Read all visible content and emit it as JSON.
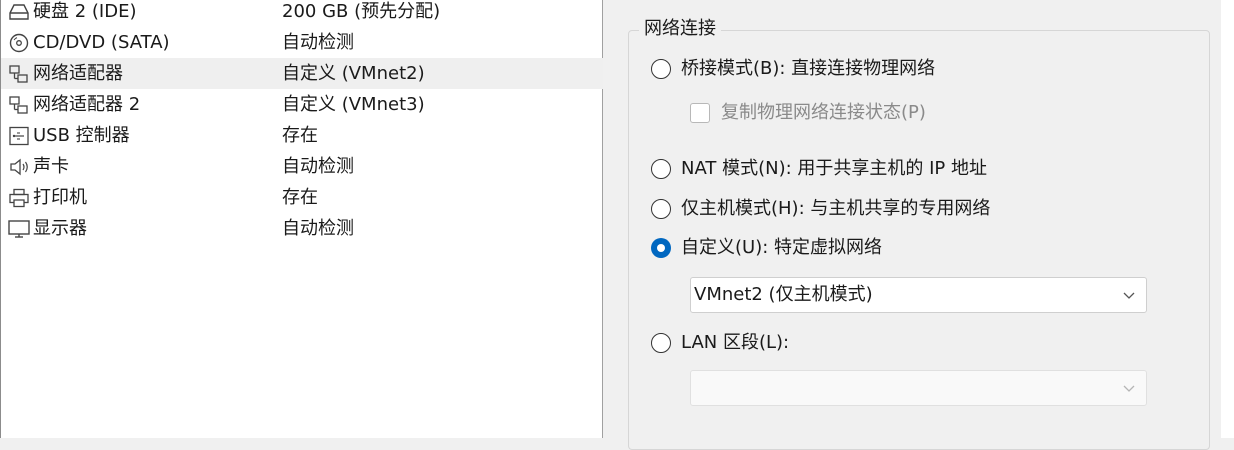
{
  "devices": [
    {
      "icon": "hard-disk-icon",
      "name": "硬盘 2 (IDE)",
      "summary": "200 GB (预先分配)"
    },
    {
      "icon": "cd-dvd-icon",
      "name": "CD/DVD (SATA)",
      "summary": "自动检测"
    },
    {
      "icon": "network-adapter-icon",
      "name": "网络适配器",
      "summary": "自定义 (VMnet2)"
    },
    {
      "icon": "network-adapter-icon",
      "name": "网络适配器 2",
      "summary": "自定义 (VMnet3)"
    },
    {
      "icon": "usb-icon",
      "name": "USB 控制器",
      "summary": "存在"
    },
    {
      "icon": "speaker-icon",
      "name": "声卡",
      "summary": "自动检测"
    },
    {
      "icon": "printer-icon",
      "name": "打印机",
      "summary": "存在"
    },
    {
      "icon": "monitor-icon",
      "name": "显示器",
      "summary": "自动检测"
    }
  ],
  "selected_device_index": 2,
  "network": {
    "group_title": "网络连接",
    "bridged": "桥接模式(B): 直接连接物理网络",
    "replicate": "复制物理网络连接状态(P)",
    "nat": "NAT 模式(N): 用于共享主机的 IP 地址",
    "host_only": "仅主机模式(H): 与主机共享的专用网络",
    "custom": "自定义(U): 特定虚拟网络",
    "custom_selected_value": "VMnet2 (仅主机模式)",
    "lan_segment": "LAN 区段(L):",
    "lan_segment_value": "",
    "selected_mode": "custom"
  },
  "colors": {
    "accent": "#0067c0"
  }
}
